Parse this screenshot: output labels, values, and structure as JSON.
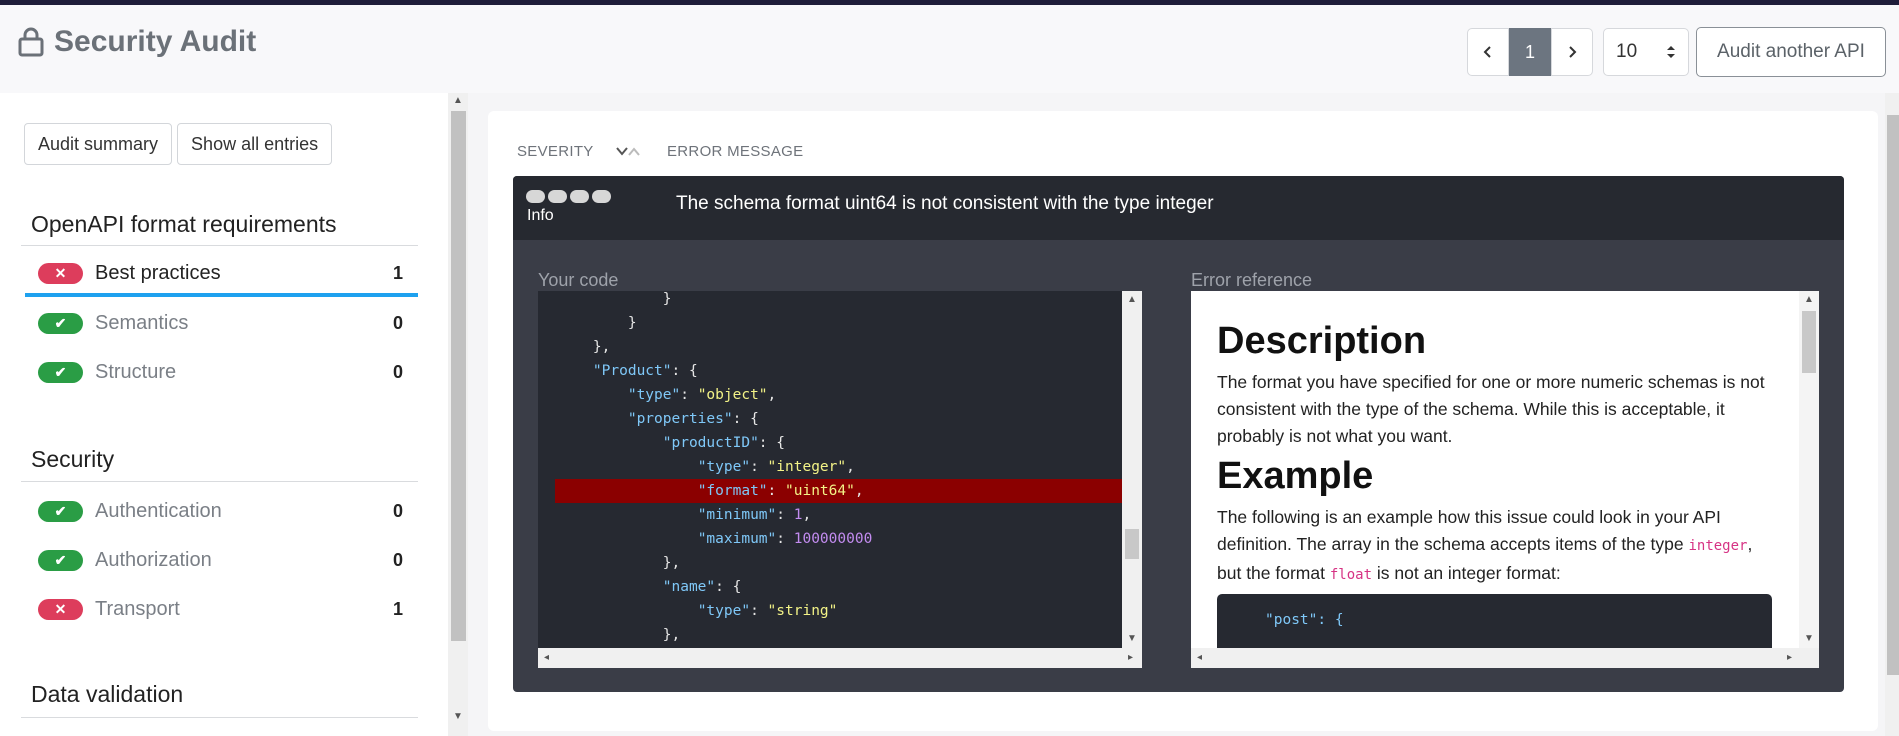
{
  "header": {
    "title": "Security Audit",
    "pager": {
      "prev": "‹",
      "current": "1",
      "next": "›"
    },
    "page_size": "10",
    "audit_another": "Audit another API"
  },
  "sidebar": {
    "buttons": {
      "summary": "Audit summary",
      "show_all": "Show all entries"
    },
    "sections": [
      {
        "title": "OpenAPI format requirements",
        "items": [
          {
            "label": "Best practices",
            "count": "1",
            "status": "fail"
          },
          {
            "label": "Semantics",
            "count": "0",
            "status": "pass"
          },
          {
            "label": "Structure",
            "count": "0",
            "status": "pass"
          }
        ]
      },
      {
        "title": "Security",
        "items": [
          {
            "label": "Authentication",
            "count": "0",
            "status": "pass"
          },
          {
            "label": "Authorization",
            "count": "0",
            "status": "pass"
          },
          {
            "label": "Transport",
            "count": "1",
            "status": "fail"
          }
        ]
      },
      {
        "title": "Data validation",
        "items": []
      }
    ]
  },
  "table": {
    "col_severity": "SEVERITY",
    "col_error": "ERROR MESSAGE"
  },
  "issue": {
    "severity": "Info",
    "message": "The schema format uint64 is not consistent with the type integer",
    "your_code_label": "Your code",
    "error_reference_label": "Error reference",
    "code_lines": [
      "            }",
      "        }",
      "    },",
      "    \"Product\": {",
      "        \"type\": \"object\",",
      "        \"properties\": {",
      "            \"productID\": {",
      "                \"type\": \"integer\",",
      "                \"format\": \"uint64\",",
      "                \"minimum\": 1,",
      "                \"maximum\": 100000000",
      "            },",
      "            \"name\": {",
      "                \"type\": \"string\"",
      "            },"
    ],
    "reference": {
      "h_description": "Description",
      "description": "The format you have specified for one or more numeric schemas is not consistent with the type of the schema. While this is acceptable, it probably is not what you want.",
      "h_example": "Example",
      "example_text_1": "The following is an example how this issue could look in your API definition. The array in the schema accepts items of the type",
      "example_code_1": "integer",
      "example_text_2": ", but the format",
      "example_code_2": "float",
      "example_text_3": "is not an integer format:",
      "example_snippet": "\"post\": {"
    }
  },
  "colors": {
    "fail": "#dd3d5c",
    "pass": "#2a9d45",
    "active_underline": "#1ea1ef",
    "highlight": "#8b0000"
  }
}
